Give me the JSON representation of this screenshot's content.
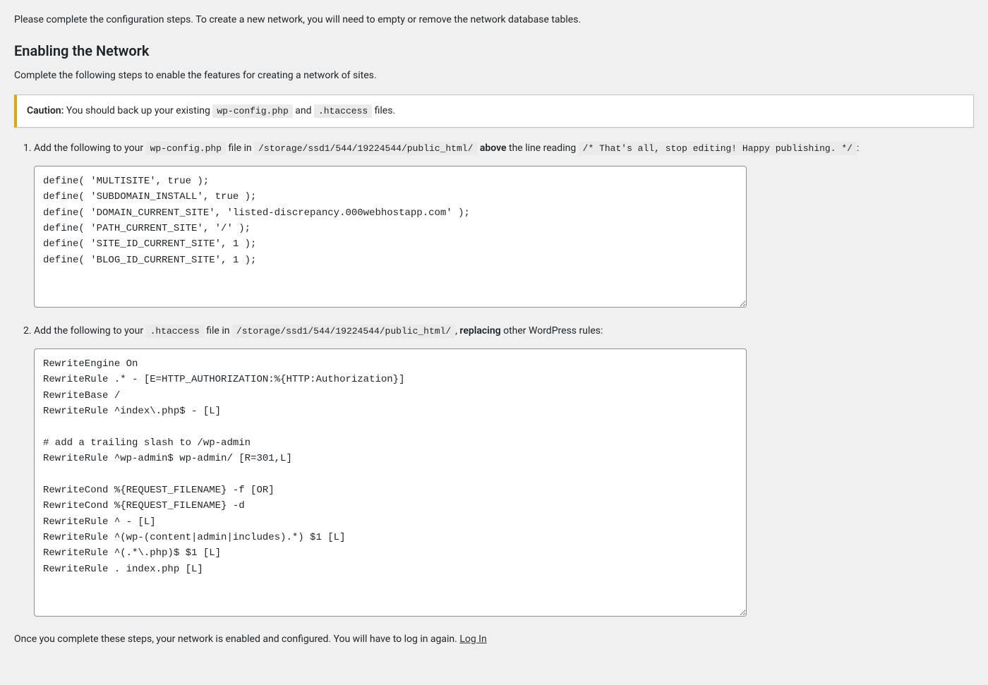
{
  "intro": "Please complete the configuration steps. To create a new network, you will need to empty or remove the network database tables.",
  "section_title": "Enabling the Network",
  "subhead": "Complete the following steps to enable the features for creating a network of sites.",
  "notice": {
    "caution_label": "Caution:",
    "text_before": " You should back up your existing ",
    "file1": "wp-config.php",
    "separator": " and ",
    "file2": ".htaccess",
    "text_after": " files."
  },
  "steps": {
    "one": {
      "text_a": "Add the following to your ",
      "wpconfig": "wp-config.php",
      "text_b": " file in ",
      "path": "/storage/ssd1/544/19224544/public_html/",
      "above_word": "above",
      "text_c": " the line reading ",
      "stop_comment": "/* That's all, stop editing! Happy publishing. */",
      "trailer": ":",
      "code": "define( 'MULTISITE', true );\ndefine( 'SUBDOMAIN_INSTALL', true );\ndefine( 'DOMAIN_CURRENT_SITE', 'listed-discrepancy.000webhostapp.com' );\ndefine( 'PATH_CURRENT_SITE', '/' );\ndefine( 'SITE_ID_CURRENT_SITE', 1 );\ndefine( 'BLOG_ID_CURRENT_SITE', 1 );\n"
    },
    "two": {
      "text_a": "Add the following to your ",
      "htaccess": ".htaccess",
      "text_b": " file in ",
      "path": "/storage/ssd1/544/19224544/public_html/",
      "comma": ", ",
      "replacing_word": "replacing",
      "text_c": " other WordPress rules:",
      "code": "RewriteEngine On\nRewriteRule .* - [E=HTTP_AUTHORIZATION:%{HTTP:Authorization}]\nRewriteBase /\nRewriteRule ^index\\.php$ - [L]\n\n# add a trailing slash to /wp-admin\nRewriteRule ^wp-admin$ wp-admin/ [R=301,L]\n\nRewriteCond %{REQUEST_FILENAME} -f [OR]\nRewriteCond %{REQUEST_FILENAME} -d\nRewriteRule ^ - [L]\nRewriteRule ^(wp-(content|admin|includes).*) $1 [L]\nRewriteRule ^(.*\\.php)$ $1 [L]\nRewriteRule . index.php [L]\n"
    }
  },
  "closing": {
    "text": "Once you complete these steps, your network is enabled and configured. You will have to log in again. ",
    "login_label": "Log In"
  }
}
